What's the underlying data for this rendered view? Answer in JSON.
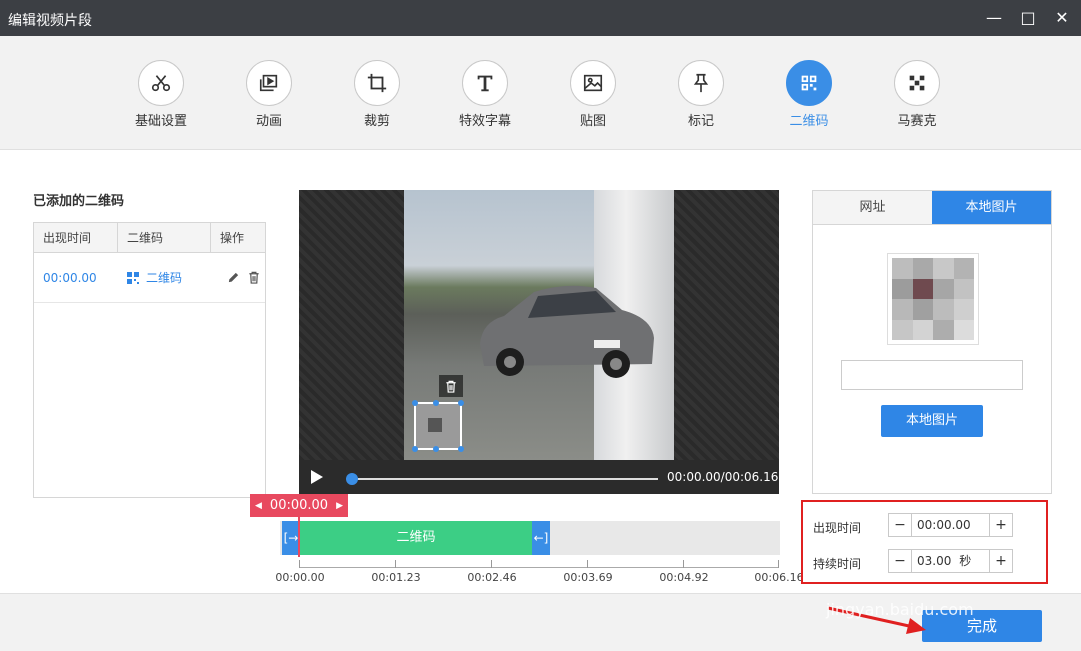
{
  "window": {
    "title": "编辑视频片段",
    "minimize_label": "—",
    "maximize_label": "□",
    "close_label": "✕"
  },
  "toolbar": {
    "items": [
      {
        "label": "基础设置",
        "icon": "scissors-icon"
      },
      {
        "label": "动画",
        "icon": "animation-icon"
      },
      {
        "label": "裁剪",
        "icon": "crop-icon"
      },
      {
        "label": "特效字幕",
        "icon": "text-icon"
      },
      {
        "label": "贴图",
        "icon": "image-icon"
      },
      {
        "label": "标记",
        "icon": "pin-icon"
      },
      {
        "label": "二维码",
        "icon": "qr-code-icon",
        "active": true
      },
      {
        "label": "马赛克",
        "icon": "mosaic-icon"
      }
    ]
  },
  "left_panel": {
    "title": "已添加的二维码",
    "columns": [
      "出现时间",
      "二维码",
      "操作"
    ],
    "rows": [
      {
        "time": "00:00.00",
        "name": "二维码"
      }
    ]
  },
  "player": {
    "time_display": "00:00.00/00:06.16",
    "progress_fraction": 0
  },
  "timeline": {
    "current_time": "00:00.00",
    "clip_label": "二维码",
    "ticks": [
      "00:00.00",
      "00:01.23",
      "00:02.46",
      "00:03.69",
      "00:04.92",
      "00:06.16"
    ]
  },
  "right_panel": {
    "tab_url": "网址",
    "tab_local": "本地图片",
    "active_tab": "本地图片",
    "path_value": "",
    "local_button": "本地图片"
  },
  "settings": {
    "appear_label": "出现时间",
    "appear_value": "00:00.00",
    "duration_label": "持续时间",
    "duration_value": "03.00",
    "duration_unit": "秒",
    "minus": "−",
    "plus": "+"
  },
  "footer": {
    "done_button": "完成",
    "watermark": "jingyan.baidu.com"
  },
  "colors": {
    "accent": "#2f86e6",
    "clip": "#3cce85",
    "playhead": "#e8495f",
    "highlight": "#e02020"
  }
}
